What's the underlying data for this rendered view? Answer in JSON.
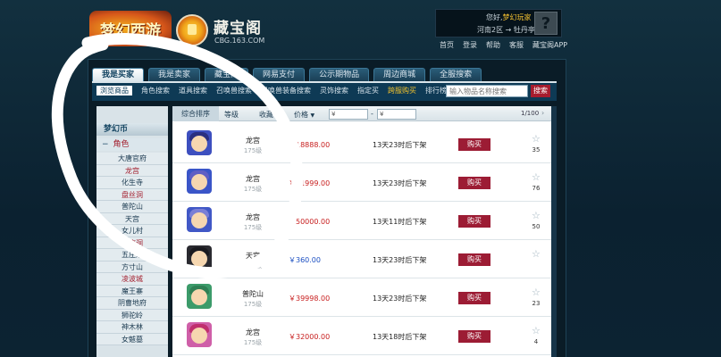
{
  "header": {
    "game_logo_text": "梦幻西游",
    "site_title": "藏宝阁",
    "site_url": "CBG.163.COM",
    "greeting_prefix": "您好,",
    "username": "梦幻玩家",
    "server_line": "河南2区 → 牡丹亭",
    "help_glyph": "?",
    "top_links": [
      "首页",
      "登录",
      "帮助",
      "客服",
      "藏宝阁APP"
    ]
  },
  "tabs": [
    {
      "label": "我是买家",
      "active": true
    },
    {
      "label": "我是卖家",
      "active": false
    },
    {
      "label": "藏宝阁",
      "active": false
    },
    {
      "label": "网易支付",
      "active": false
    },
    {
      "label": "公示期物品",
      "active": false
    },
    {
      "label": "周边商城",
      "active": false
    },
    {
      "label": "全服搜索",
      "active": false
    }
  ],
  "subnav": [
    {
      "label": "浏览商品",
      "state": "active"
    },
    {
      "label": "角色搜索",
      "state": "normal"
    },
    {
      "label": "道具搜索",
      "state": "normal"
    },
    {
      "label": "召唤兽搜索",
      "state": "normal"
    },
    {
      "label": "召唤兽装备搜索",
      "state": "normal"
    },
    {
      "label": "灵饰搜索",
      "state": "normal"
    },
    {
      "label": "指定买",
      "state": "normal"
    },
    {
      "label": "跨服购买",
      "state": "highlight"
    },
    {
      "label": "排行榜",
      "state": "normal"
    }
  ],
  "search": {
    "placeholder": "输入物品名称搜索",
    "button": "搜索"
  },
  "sidebar": {
    "section": "梦幻币",
    "category": "角色",
    "category_marker": "−",
    "items": [
      {
        "label": "大唐官府",
        "red": false
      },
      {
        "label": "龙宫",
        "red": true
      },
      {
        "label": "化生寺",
        "red": false
      },
      {
        "label": "盘丝洞",
        "red": true
      },
      {
        "label": "普陀山",
        "red": false
      },
      {
        "label": "天宫",
        "red": false
      },
      {
        "label": "女儿村",
        "red": false
      },
      {
        "label": "无底洞",
        "red": true
      },
      {
        "label": "五庄观",
        "red": false
      },
      {
        "label": "方寸山",
        "red": false
      },
      {
        "label": "凌波城",
        "red": true
      },
      {
        "label": "魔王寨",
        "red": false
      },
      {
        "label": "阴曹地府",
        "red": false
      },
      {
        "label": "狮驼岭",
        "red": false
      },
      {
        "label": "神木林",
        "red": false
      },
      {
        "label": "女魃墓",
        "red": false
      }
    ]
  },
  "table_header": {
    "sort_button": "综合排序",
    "col_level": "等级",
    "col_fav": "收藏",
    "col_price": "价格",
    "price_arrow": "▼",
    "currency": "¥",
    "range_dash": "-",
    "pager": "1/100",
    "next_arrow": "›"
  },
  "rows": [
    {
      "server": "龙宫",
      "level": "175级",
      "price": "￥18888.00",
      "price_color": "red",
      "status": "13天23时后下架",
      "buy": "购买",
      "fav": "35",
      "avatar_color": "#3d4fbf",
      "hair_color": "#2a2f80"
    },
    {
      "server": "龙宫",
      "level": "175级",
      "price": "￥41999.00",
      "price_color": "red",
      "status": "13天23时后下架",
      "buy": "购买",
      "fav": "76",
      "avatar_color": "#3a55c8",
      "hair_color": "#5f5fc4"
    },
    {
      "server": "龙宫",
      "level": "175级",
      "price": "￥50000.00",
      "price_color": "red",
      "status": "13天11时后下架",
      "buy": "购买",
      "fav": "50",
      "avatar_color": "#4158c6",
      "hair_color": "#7a7fd6"
    },
    {
      "server": "天宫",
      "level": "175级",
      "price": "￥360.00",
      "price_color": "blue",
      "status": "13天23时后下架",
      "buy": "购买",
      "fav": "",
      "avatar_color": "#2a2a30",
      "hair_color": "#1a1a1f"
    },
    {
      "server": "普陀山",
      "level": "175级",
      "price": "￥39998.00",
      "price_color": "red",
      "status": "13天23时后下架",
      "buy": "购买",
      "fav": "23",
      "avatar_color": "#3c9b6a",
      "hair_color": "#2f7f54"
    },
    {
      "server": "龙宫",
      "level": "175级",
      "price": "￥32000.00",
      "price_color": "red",
      "status": "13天18时后下架",
      "buy": "购买",
      "fav": "4",
      "avatar_color": "#cf5fa8",
      "hair_color": "#c0306e"
    }
  ]
}
